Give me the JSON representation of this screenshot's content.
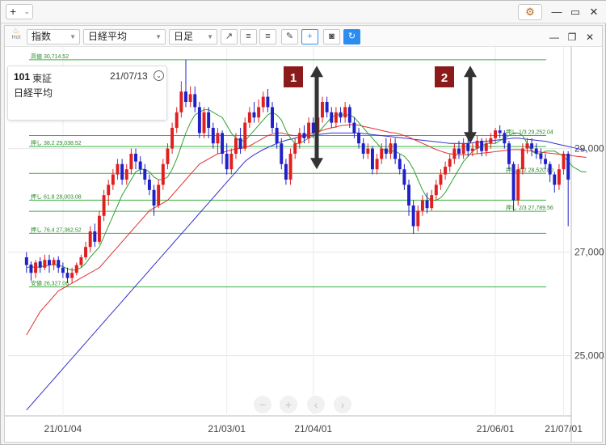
{
  "window": {
    "add_label": "+",
    "add_caret": "⌄",
    "gear_icon": "⚙",
    "minimize": "—",
    "maximize": "▭",
    "close": "✕"
  },
  "toolbar": {
    "hot_label": "Hot",
    "type_select": "指数",
    "symbol_select": "日経平均",
    "period_select": "日足",
    "tool_icons": [
      "↗",
      "≡",
      "≡",
      "✎",
      "+",
      "◙",
      "↻"
    ],
    "panel_controls": [
      "—",
      "❐",
      "✕"
    ]
  },
  "info": {
    "code": "101",
    "exchange": "東証",
    "date": "21/07/13",
    "toggle": "⌄",
    "name": "日経平均"
  },
  "nav": [
    "−",
    "+",
    "‹",
    "›"
  ],
  "chart_data": {
    "type": "candlestick",
    "x_ticks": [
      "21/01/04",
      "21/03/01",
      "21/04/01",
      "21/06/01",
      "21/07/01"
    ],
    "y_ticks": [
      25000,
      27000,
      29000
    ],
    "y_tick_labels": [
      "25,000",
      "27,000",
      "29,000"
    ],
    "ylim": [
      23900,
      30900
    ],
    "up_color": "#e02020",
    "down_color": "#2020c8",
    "fib_levels": [
      {
        "label": "高値 30,714.52",
        "value": 30714.52
      },
      {
        "label": "押し 1/3 29,252.04",
        "value": 29252.04
      },
      {
        "label": "押し 38.2 29,038.52",
        "value": 29038.52
      },
      {
        "label": "押し 1/2 28,520.80",
        "value": 28520.8
      },
      {
        "label": "押し 61.8 28,003.08",
        "value": 28003.08
      },
      {
        "label": "押し 2/3 27,789.56",
        "value": 27789.56
      },
      {
        "label": "押し 76.4 27,362.52",
        "value": 27362.52
      },
      {
        "label": "安値 26,327.06",
        "value": 26327.06
      }
    ],
    "annotations": [
      {
        "label": "1",
        "date_x": "21/04/06",
        "from": 28600,
        "to": 30600
      },
      {
        "label": "2",
        "date_x": "21/06/14",
        "from": 29100,
        "to": 30600
      }
    ],
    "candles": [
      [
        26900,
        26750,
        27000,
        26600
      ],
      [
        26760,
        26600,
        26820,
        26450
      ],
      [
        26600,
        26800,
        26850,
        26500
      ],
      [
        26820,
        26700,
        26900,
        26600
      ],
      [
        26700,
        26850,
        26950,
        26650
      ],
      [
        26850,
        26750,
        26950,
        26600
      ],
      [
        26750,
        26850,
        26900,
        26650
      ],
      [
        26850,
        26700,
        26920,
        26600
      ],
      [
        26700,
        26600,
        26800,
        26500
      ],
      [
        26600,
        26500,
        26700,
        26400
      ],
      [
        26500,
        26600,
        26700,
        26400
      ],
      [
        26600,
        26750,
        26800,
        26550
      ],
      [
        26750,
        26900,
        26950,
        26700
      ],
      [
        26900,
        27100,
        27200,
        26850
      ],
      [
        27100,
        27400,
        27500,
        27000
      ],
      [
        27400,
        27200,
        27550,
        27100
      ],
      [
        27200,
        27700,
        27800,
        27150
      ],
      [
        27700,
        28100,
        28200,
        27600
      ],
      [
        28100,
        28300,
        28400,
        27900
      ],
      [
        28300,
        28500,
        28600,
        28200
      ],
      [
        28500,
        28700,
        28800,
        28400
      ],
      [
        28700,
        28400,
        28800,
        28300
      ],
      [
        28400,
        28600,
        28700,
        28300
      ],
      [
        28600,
        28900,
        29000,
        28500
      ],
      [
        28900,
        28750,
        29000,
        28600
      ],
      [
        28750,
        28600,
        28850,
        28500
      ],
      [
        28600,
        28400,
        28700,
        28300
      ],
      [
        28400,
        28200,
        28500,
        28100
      ],
      [
        28200,
        27900,
        28300,
        27700
      ],
      [
        27900,
        28300,
        28400,
        27850
      ],
      [
        28300,
        28700,
        28800,
        28200
      ],
      [
        28700,
        29000,
        29100,
        28600
      ],
      [
        29000,
        29400,
        29500,
        28900
      ],
      [
        29400,
        29700,
        29800,
        29300
      ],
      [
        29700,
        30100,
        30300,
        29600
      ],
      [
        30100,
        29900,
        30714,
        29800
      ],
      [
        29900,
        30050,
        30200,
        29800
      ],
      [
        30050,
        29800,
        30200,
        29700
      ],
      [
        29800,
        29300,
        29900,
        29200
      ],
      [
        29300,
        29700,
        29800,
        29200
      ],
      [
        29700,
        29400,
        29800,
        29200
      ],
      [
        29400,
        29100,
        29500,
        29000
      ],
      [
        29100,
        29300,
        29400,
        28900
      ],
      [
        29300,
        28900,
        29350,
        28700
      ],
      [
        28900,
        28600,
        29100,
        28500
      ],
      [
        28600,
        28900,
        29000,
        28500
      ],
      [
        28900,
        29200,
        29300,
        28800
      ],
      [
        29200,
        29000,
        29400,
        28900
      ],
      [
        29000,
        29500,
        29600,
        28950
      ],
      [
        29500,
        29700,
        29800,
        29400
      ],
      [
        29700,
        29600,
        29900,
        29500
      ],
      [
        29600,
        29800,
        29950,
        29500
      ],
      [
        29800,
        30000,
        30100,
        29700
      ],
      [
        30000,
        29800,
        30150,
        29700
      ],
      [
        29800,
        29400,
        29900,
        29300
      ],
      [
        29400,
        29100,
        29500,
        29000
      ],
      [
        29100,
        28700,
        29200,
        28600
      ],
      [
        28700,
        28400,
        28800,
        28300
      ],
      [
        28400,
        28900,
        29000,
        28300
      ],
      [
        28900,
        29100,
        29200,
        28800
      ],
      [
        29100,
        29300,
        29400,
        29000
      ],
      [
        29300,
        29200,
        29450,
        29100
      ],
      [
        29200,
        29500,
        29600,
        29100
      ],
      [
        29500,
        29300,
        29600,
        29200
      ],
      [
        29300,
        29600,
        29700,
        29200
      ],
      [
        29600,
        29900,
        30000,
        29500
      ],
      [
        29900,
        29700,
        30000,
        29600
      ],
      [
        29700,
        29500,
        29800,
        29400
      ],
      [
        29500,
        29700,
        29800,
        29400
      ],
      [
        29700,
        29600,
        29800,
        29500
      ],
      [
        29600,
        29800,
        29900,
        29500
      ],
      [
        29800,
        29500,
        29850,
        29400
      ],
      [
        29500,
        29300,
        29600,
        29200
      ],
      [
        29300,
        29100,
        29400,
        29000
      ],
      [
        29100,
        28900,
        29200,
        28800
      ],
      [
        28900,
        29000,
        29100,
        28800
      ],
      [
        29000,
        28600,
        29050,
        28500
      ],
      [
        28600,
        28800,
        28900,
        28500
      ],
      [
        28800,
        29000,
        29100,
        28700
      ],
      [
        29000,
        28900,
        29200,
        28800
      ],
      [
        28900,
        29100,
        29200,
        28800
      ],
      [
        29100,
        28800,
        29200,
        28700
      ],
      [
        28800,
        28600,
        28900,
        28500
      ],
      [
        28600,
        28300,
        28700,
        28200
      ],
      [
        28300,
        27900,
        28400,
        27700
      ],
      [
        27900,
        27500,
        28000,
        27350
      ],
      [
        27500,
        27800,
        27900,
        27400
      ],
      [
        27800,
        28000,
        28100,
        27700
      ],
      [
        28000,
        27850,
        28150,
        27750
      ],
      [
        27850,
        28100,
        28200,
        27800
      ],
      [
        28100,
        28300,
        28400,
        28000
      ],
      [
        28300,
        28500,
        28600,
        28200
      ],
      [
        28500,
        28650,
        28750,
        28400
      ],
      [
        28650,
        28800,
        28900,
        28550
      ],
      [
        28800,
        29000,
        29100,
        28700
      ],
      [
        29000,
        28900,
        29150,
        28800
      ],
      [
        28900,
        29100,
        29200,
        28800
      ],
      [
        29100,
        28950,
        29200,
        28850
      ],
      [
        28950,
        29000,
        29100,
        28850
      ],
      [
        29000,
        29150,
        29250,
        28900
      ],
      [
        29150,
        28950,
        29200,
        28850
      ],
      [
        28950,
        29100,
        29200,
        28850
      ],
      [
        29100,
        29200,
        29300,
        29000
      ],
      [
        29200,
        29350,
        29400,
        29100
      ],
      [
        29350,
        29300,
        29450,
        29200
      ],
      [
        29300,
        29100,
        29350,
        29000
      ],
      [
        29100,
        28700,
        29150,
        28600
      ],
      [
        28700,
        28000,
        28750,
        27800
      ],
      [
        28000,
        28600,
        28700,
        27900
      ],
      [
        28600,
        29000,
        29100,
        28500
      ],
      [
        29000,
        29100,
        29200,
        28900
      ],
      [
        29100,
        29000,
        29200,
        28850
      ],
      [
        29000,
        28900,
        29100,
        28800
      ],
      [
        28900,
        28800,
        29000,
        28700
      ],
      [
        28800,
        28700,
        28900,
        28600
      ],
      [
        28700,
        28500,
        28750,
        28350
      ],
      [
        28500,
        28300,
        28550,
        28150
      ],
      [
        28300,
        28600,
        28700,
        28200
      ],
      [
        28600,
        28900,
        28950,
        28500
      ],
      [
        28900,
        28400,
        28950,
        27500
      ]
    ],
    "ma_short": [
      26700,
      26720,
      26700,
      26720,
      26730,
      26750,
      26760,
      26750,
      26720,
      26680,
      26650,
      26660,
      26700,
      26780,
      26900,
      27000,
      27100,
      27300,
      27500,
      27700,
      27900,
      28100,
      28250,
      28400,
      28550,
      28600,
      28600,
      28550,
      28450,
      28400,
      28400,
      28450,
      28600,
      28800,
      29050,
      29300,
      29500,
      29650,
      29700,
      29750,
      29750,
      29700,
      29650,
      29600,
      29450,
      29300,
      29200,
      29150,
      29150,
      29250,
      29350,
      29450,
      29550,
      29650,
      29700,
      29650,
      29550,
      29350,
      29200,
      29100,
      29100,
      29150,
      29200,
      29250,
      29300,
      29400,
      29500,
      29600,
      29650,
      29650,
      29650,
      29650,
      29600,
      29500,
      29400,
      29300,
      29200,
      29100,
      29000,
      28950,
      28950,
      28950,
      28900,
      28850,
      28750,
      28600,
      28400,
      28200,
      28050,
      28000,
      28000,
      28050,
      28150,
      28300,
      28450,
      28600,
      28750,
      28850,
      28950,
      29000,
      29050,
      29100,
      29100,
      29100,
      29150,
      29200,
      29250,
      29300,
      29300,
      29250,
      29100,
      28950,
      28900,
      28900,
      28950,
      28950,
      28950,
      28900,
      28850,
      28750,
      28650,
      28600,
      28550,
      28550
    ],
    "ma_mid": [
      25400,
      25550,
      25700,
      25850,
      25950,
      26050,
      26150,
      26250,
      26300,
      26350,
      26400,
      26450,
      26500,
      26550,
      26600,
      26650,
      26700,
      26800,
      26900,
      27000,
      27100,
      27200,
      27300,
      27400,
      27500,
      27600,
      27700,
      27800,
      27850,
      27900,
      27950,
      28000,
      28100,
      28200,
      28300,
      28400,
      28500,
      28600,
      28700,
      28750,
      28800,
      28850,
      28900,
      28920,
      28950,
      28970,
      29000,
      29000,
      29020,
      29050,
      29100,
      29150,
      29200,
      29250,
      29280,
      29300,
      29300,
      29280,
      29260,
      29250,
      29250,
      29260,
      29280,
      29300,
      29320,
      29350,
      29380,
      29400,
      29420,
      29440,
      29450,
      29460,
      29460,
      29450,
      29430,
      29410,
      29390,
      29370,
      29350,
      29330,
      29310,
      29300,
      29280,
      29250,
      29220,
      29180,
      29140,
      29100,
      29060,
      29020,
      28980,
      28950,
      28920,
      28900,
      28890,
      28880,
      28880,
      28880,
      28890,
      28900,
      28910,
      28920,
      28930,
      28940,
      28950,
      28960,
      28970,
      28980,
      28980,
      28970,
      28960,
      28950,
      28940,
      28930,
      28920,
      28910,
      28900,
      28890,
      28880,
      28870,
      28860,
      28850,
      28840,
      28830
    ],
    "ma_long": [
      23950,
      24050,
      24150,
      24250,
      24350,
      24450,
      24550,
      24650,
      24750,
      24850,
      24950,
      25050,
      25150,
      25250,
      25350,
      25450,
      25550,
      25650,
      25750,
      25850,
      25950,
      26050,
      26150,
      26250,
      26350,
      26450,
      26550,
      26650,
      26750,
      26850,
      26950,
      27050,
      27150,
      27250,
      27350,
      27450,
      27550,
      27650,
      27750,
      27850,
      27950,
      28050,
      28150,
      28250,
      28350,
      28450,
      28550,
      28650,
      28750,
      28820,
      28880,
      28930,
      28980,
      29020,
      29060,
      29100,
      29130,
      29160,
      29180,
      29200,
      29220,
      29240,
      29250,
      29260,
      29270,
      29280,
      29290,
      29300,
      29300,
      29300,
      29300,
      29300,
      29300,
      29300,
      29290,
      29280,
      29270,
      29260,
      29250,
      29240,
      29230,
      29220,
      29210,
      29200,
      29190,
      29180,
      29170,
      29160,
      29150,
      29140,
      29130,
      29120,
      29110,
      29100,
      29100,
      29100,
      29100,
      29100,
      29110,
      29120,
      29130,
      29140,
      29150,
      29160,
      29170,
      29180,
      29190,
      29200,
      29200,
      29190,
      29180,
      29170,
      29160,
      29150,
      29140,
      29120,
      29100,
      29080,
      29060,
      29040,
      29020,
      29000,
      28980,
      28960
    ]
  }
}
